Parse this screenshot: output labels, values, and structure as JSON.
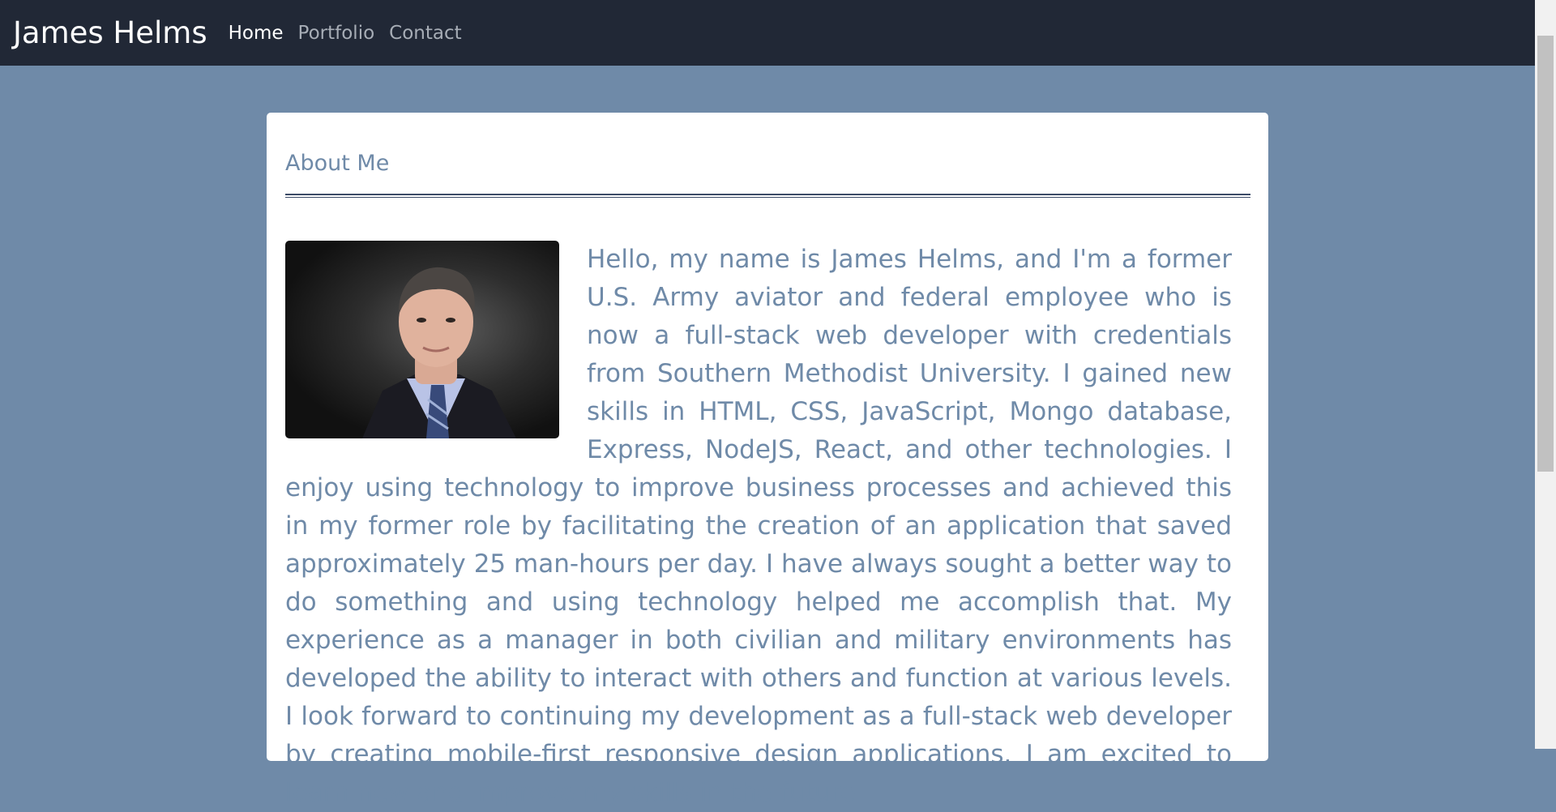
{
  "navbar": {
    "brand": "James Helms",
    "links": [
      {
        "label": "Home",
        "active": true
      },
      {
        "label": "Portfolio",
        "active": false
      },
      {
        "label": "Contact",
        "active": false
      }
    ]
  },
  "about": {
    "title": "About Me",
    "photo_icon": "portrait-photo",
    "bio": "Hello, my name is James Helms, and I'm a former U.S. Army aviator and federal employee who is now a full-stack web developer with credentials from Southern Methodist University. I gained new skills in HTML, CSS, JavaScript, Mongo database, Express, NodeJS, React, and other technologies. I enjoy using technology to improve business processes and achieved this in my former role by facilitating the creation of an application that saved approximately 25 man-hours per day. I have always sought a better way to do something and using technology helped me accomplish that. My experience as a manager in both civilian and military environments has developed the ability to interact with others and function at various levels. I look forward to continuing my development as a full-stack web developer by creating mobile-first responsive design applications. I am excited to learn new and improve my skills in the future."
  },
  "colors": {
    "navbar_bg": "#212836",
    "page_bg": "#6f8aa8",
    "text_accent": "#6f8aa8"
  }
}
